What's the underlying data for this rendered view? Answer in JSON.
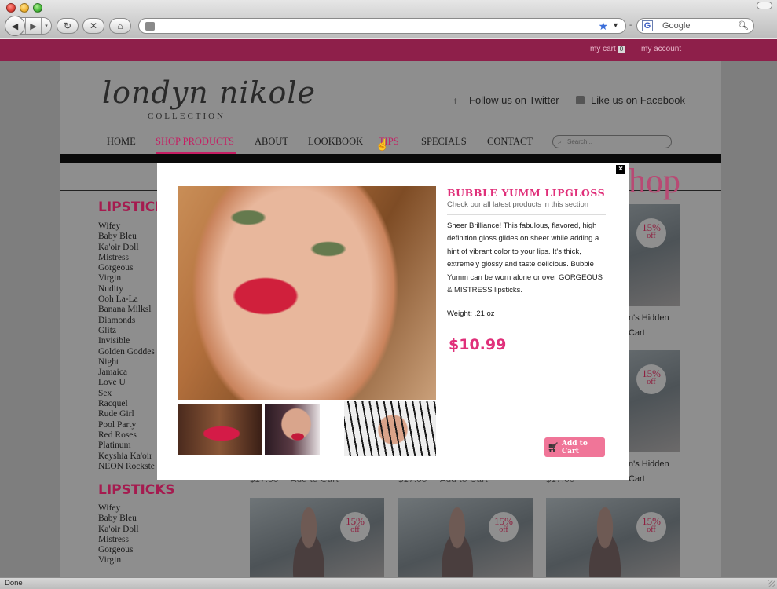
{
  "browser": {
    "address_url": "",
    "search_placeholder": "Google",
    "status_text": "Done"
  },
  "topbar": {
    "my_cart": "my cart",
    "cart_count": "0",
    "my_account": "my account"
  },
  "brand": {
    "logo_script": "londyn nikole",
    "logo_collection": "COLLECTION"
  },
  "social": {
    "twitter": "Follow us on Twitter",
    "facebook": "Like us on Facebook"
  },
  "nav": {
    "items": [
      "HOME",
      "SHOP PRODUCTS",
      "ABOUT",
      "LOOKBOOK",
      "TIPS",
      "SPECIALS",
      "CONTACT"
    ],
    "active": "SHOP PRODUCTS",
    "search_placeholder": "Search..."
  },
  "shop_heading": "hop",
  "sidebar": {
    "sections": [
      {
        "title": "LIPSTICKS",
        "items": [
          "Wifey",
          "Baby Bleu",
          "Ka'oir Doll",
          "Mistress",
          "Gorgeous",
          "Virgin",
          "Nudity",
          "Ooh La-La",
          "Banana Milksl",
          "Diamonds",
          "Glitz",
          "Invisible",
          "Golden Goddes",
          "Night",
          "Jamaica",
          "Love U",
          "Sex",
          "Racquel",
          "Rude Girl",
          "Pool Party",
          "Red Roses",
          "Platinum",
          "Keyshia Ka'oir",
          "NEON Rockste"
        ]
      },
      {
        "title": "LIPSTICKS",
        "items": [
          "Wifey",
          "Baby Bleu",
          "Ka'oir Doll",
          "Mistress",
          "Gorgeous",
          "Virgin"
        ]
      }
    ]
  },
  "products": {
    "badge_percent": "15%",
    "badge_off": "off",
    "name_fragment": "n's Hidden",
    "cart_fragment": "Cart",
    "add_to_cart_dim": "Add to Cart",
    "price_dim": "$17.00"
  },
  "modal": {
    "close": "×",
    "title": "BUBBLE YUMM LIPGLOSS",
    "subtitle": "Check our all latest products in this section",
    "description": "Sheer Brilliance! This fabulous, flavored, high definition gloss glides on sheer while adding a hint of vibrant color to your lips. It's thick, extremely glossy and taste delicious. Bubble Yumm can be worn alone or over GORGEOUS & MISTRESS lipsticks.",
    "weight": "Weight: .21 oz",
    "price": "$10.99",
    "add_to_cart": "Add to Cart"
  },
  "colors": {
    "accent_pink": "#e0307a",
    "topbar": "#8e1f4a",
    "button_pink": "#f07598"
  }
}
